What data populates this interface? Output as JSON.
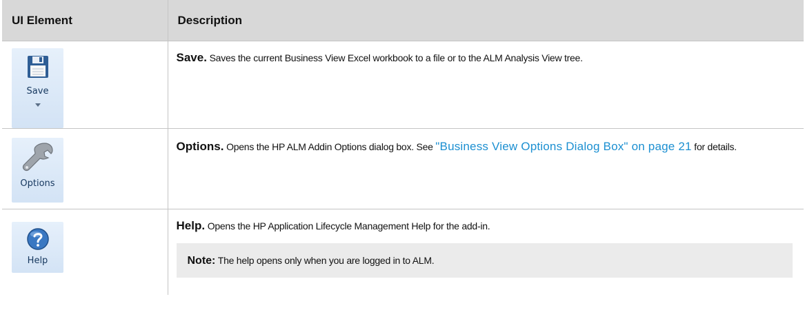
{
  "table": {
    "headers": [
      "UI Element",
      "Description"
    ],
    "rows": [
      {
        "button_label": "Save",
        "icon": "floppy-disk-icon",
        "term": "Save.",
        "text": " Saves the current Business View Excel workbook to a file or to the ALM Analysis View tree."
      },
      {
        "button_label": "Options",
        "icon": "wrench-icon",
        "term": "Options.",
        "text_before": " Opens the HP ALM Addin Options dialog box. See ",
        "link": "\"Business View Options Dialog Box\" on page 21",
        "text_after": " for details."
      },
      {
        "button_label": "Help",
        "icon": "question-mark-icon",
        "term": "Help.",
        "text": " Opens the HP Application Lifecycle Management Help for the add-in.",
        "note_term": "Note:",
        "note_text": " The help opens only when you are logged in to ALM."
      }
    ]
  },
  "colors": {
    "header_bg": "#d8d8d8",
    "link": "#1b8fd1",
    "note_bg": "#ebebeb",
    "ribbon_bg": "#dde9f7"
  }
}
